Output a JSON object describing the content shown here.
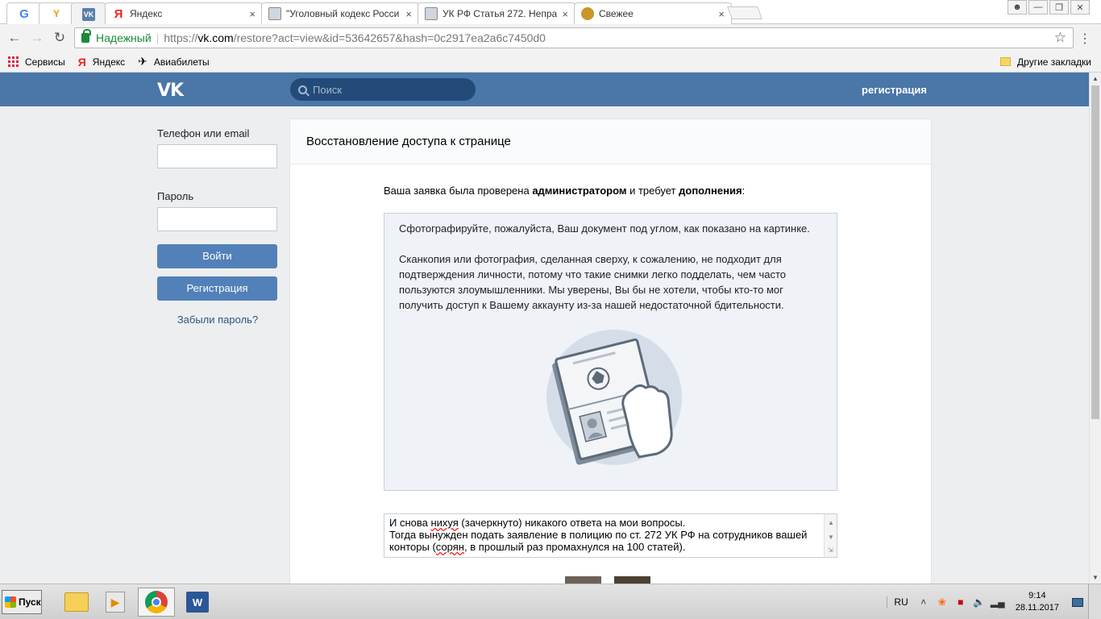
{
  "browser": {
    "tabs": [
      {
        "id": "google",
        "title": "",
        "favicon": "google-icon"
      },
      {
        "id": "yandex-pinned",
        "title": "",
        "favicon": "yandex-browser-icon"
      },
      {
        "id": "vk",
        "title": "",
        "favicon": "vk-icon",
        "active": true
      },
      {
        "id": "yandex",
        "title": "Яндекс",
        "favicon": "yandex-icon"
      },
      {
        "id": "criminal-code",
        "title": "\"Уголовный кодекс Росси",
        "favicon": "image-icon"
      },
      {
        "id": "article-272",
        "title": "УК РФ Статья 272. Непра",
        "favicon": "image-icon"
      },
      {
        "id": "fresh",
        "title": "Свежее",
        "favicon": "fresh-icon"
      }
    ],
    "tab_close": "×",
    "address": {
      "secure_label": "Надежный",
      "protocol": "https://",
      "host": "vk.com",
      "path": "/restore?act=view&id=53642657&hash=0c2917ea2a6c7450d0"
    },
    "bookmarks": [
      {
        "label": "Сервисы",
        "icon": "apps-icon"
      },
      {
        "label": "Яндекс",
        "icon": "yandex-icon"
      },
      {
        "label": "Авиабилеты",
        "icon": "plane-icon"
      }
    ],
    "other_bookmarks": "Другие закладки"
  },
  "vk": {
    "logo": "VK",
    "search_placeholder": "Поиск",
    "register_link": "регистрация",
    "login": {
      "phone_label": "Телефон или email",
      "password_label": "Пароль",
      "login_button": "Войти",
      "register_button": "Регистрация",
      "forgot_link": "Забыли пароль?"
    },
    "restore": {
      "title": "Восстановление доступа к странице",
      "intro_prefix": "Ваша заявка была проверена ",
      "intro_bold1": "администратором",
      "intro_mid": " и требует ",
      "intro_bold2": "дополнения",
      "intro_suffix": ":",
      "instruction_1": "Сфотографируйте, пожалуйста, Ваш документ под углом, как показано на картинке.",
      "instruction_2": "Сканкопия или фотография, сделанная сверху, к сожалению, не подходит для подтверждения личности, потому что такие снимки легко подделать, чем часто пользуются злоумышленники. Мы уверены, Вы бы не хотели, чтобы кто-то мог получить доступ к Вашему аккаунту из-за нашей недостаточной бдительности.",
      "reply_lines": [
        {
          "parts": [
            {
              "t": "И снова "
            },
            {
              "t": "нихуя",
              "spell": true
            },
            {
              "t": " (зачеркнуто) никакого ответа на мои вопросы."
            }
          ]
        },
        {
          "parts": [
            {
              "t": "Тогда вынужден подать заявление в полицию по ст. 272 УК РФ на сотрудников вашей"
            }
          ]
        },
        {
          "parts": [
            {
              "t": "конторы ("
            },
            {
              "t": "сорян",
              "spell": true
            },
            {
              "t": ", в прошлый раз промахнулся на 100 статей)."
            }
          ]
        }
      ]
    }
  },
  "taskbar": {
    "start_label": "Пуск",
    "language": "RU",
    "time": "9:14",
    "date": "28.11.2017"
  },
  "colors": {
    "vk_header": "#4a76a8",
    "vk_button": "#5181b8",
    "secure_green": "#1a8a3a"
  }
}
